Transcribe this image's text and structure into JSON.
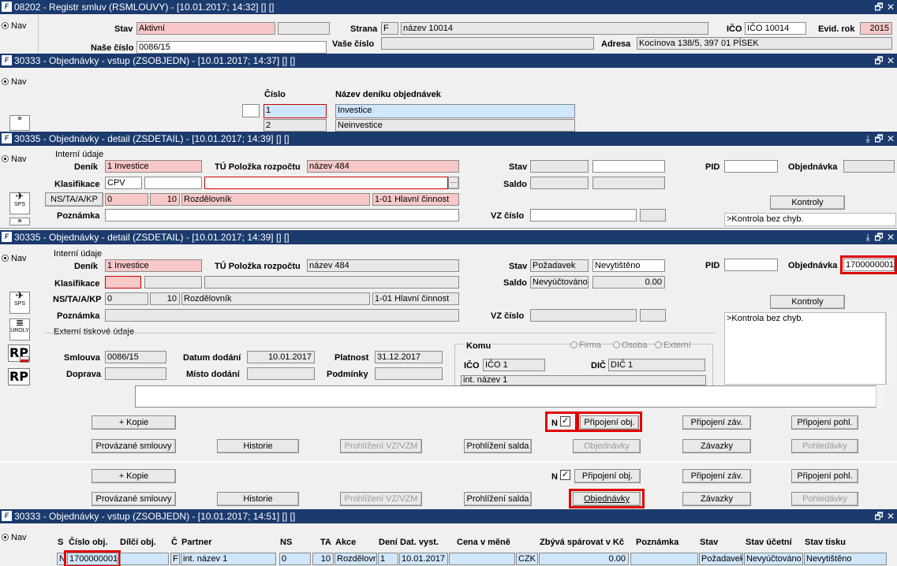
{
  "w1": {
    "title": "08202 - Registr smluv (RSMLOUVY) - [10.01.2017; 14:32] [] []",
    "nav": "Nav",
    "stav_label": "Stav",
    "stav_value": "Aktivní",
    "nase_cislo_label": "Naše číslo",
    "nase_cislo_value": "0086/15",
    "strana_label": "Strana",
    "strana_code": "F",
    "strana_value": "název 10014",
    "vase_cislo_label": "Vaše číslo",
    "ico_label": "IČO",
    "ico_value": "IČO 10014",
    "evid_rok_label": "Evid. rok",
    "evid_rok_value": "2015",
    "adresa_label": "Adresa",
    "adresa_value": "Kocínova 138/5, 397 01 PÍSEK"
  },
  "w2": {
    "title": "30333 - Objednávky - vstup (ZSOBJEDN) - [10.01.2017; 14:37] [] []",
    "nav": "Nav",
    "col_cislo": "Číslo",
    "col_nazev": "Název deníku objednávek",
    "rows": [
      {
        "cislo": "1",
        "nazev": "Investice"
      },
      {
        "cislo": "2",
        "nazev": "Neinvestice"
      }
    ]
  },
  "w3": {
    "title": "30335 - Objednávky - detail (ZSDETAIL) - [10.01.2017; 14:39] [] []",
    "nav": "Nav",
    "group": "Interní údaje",
    "denik_label": "Deník",
    "denik_value": "1 Investice",
    "tu_label": "TÚ Položka rozpočtu",
    "tu_value": "název 484",
    "klasifikace_label": "Klasifikace",
    "klasifikace_value": "CPV",
    "ns_button": "NS/TA/A/KP",
    "ns_value": "0",
    "ta_value": "10",
    "a_value": "Rozdělovník",
    "kp_value": "1-01 Hlavní činnost",
    "poznamka_label": "Poznámka",
    "stav_label": "Stav",
    "saldo_label": "Saldo",
    "vz_label": "VZ číslo",
    "pid_label": "PID",
    "objednavka_label": "Objednávka",
    "kontroly_button": "Kontroly",
    "kontroly_text": ">Kontrola bez chyb.",
    "ellipsis": "···"
  },
  "w4": {
    "title": "30335 - Objednávky - detail (ZSDETAIL) - [10.01.2017; 14:39] [] []",
    "nav": "Nav",
    "group": "Interní údaje",
    "denik_label": "Deník",
    "denik_value": "1 Investice",
    "tu_label": "TÚ Položka rozpočtu",
    "tu_value": "název 484",
    "klasifikace_label": "Klasifikace",
    "ns_label": "NS/TA/A/KP",
    "ns_value": "0",
    "ta_value": "10",
    "a_value": "Rozdělovník",
    "kp_value": "1-01 Hlavní činnost",
    "poznamka_label": "Poznámka",
    "stav_label": "Stav",
    "stav_value1": "Požadavek",
    "stav_value2": "Nevytištěno",
    "saldo_label": "Saldo",
    "saldo_value1": "Nevyúčtováno",
    "saldo_value2": "0.00",
    "vz_label": "VZ číslo",
    "pid_label": "PID",
    "objednavka_label": "Objednávka",
    "objednavka_value": "1700000001",
    "kontroly_button": "Kontroly",
    "kontroly_text": ">Kontrola bez chyb.",
    "ext_group": "Externí tiskové údaje",
    "smlouva_label": "Smlouva",
    "smlouva_value": "0086/15",
    "datum_dodani_label": "Datum dodání",
    "datum_dodani_value": "10.01.2017",
    "platnost_label": "Platnost",
    "platnost_value": "31.12.2017",
    "doprava_label": "Doprava",
    "misto_label": "Místo dodání",
    "podminky_label": "Podmínky",
    "komu_label": "Komu",
    "radio_firma": "Firma",
    "radio_osoba": "Osoba",
    "radio_externi": "Externí",
    "ico_label": "IČO",
    "ico_value": "IČO 1",
    "dic_label": "DIČ",
    "dic_value": "DIČ 1",
    "int_nazev": "int. název 1"
  },
  "buttons1": {
    "kopie": "+ Kopie",
    "n_label": "N",
    "check": "✓",
    "pripojeni_obj": "Připojení obj.",
    "pripojeni_zav": "Připojení záv.",
    "pripojeni_pohl": "Připojení pohl.",
    "provazane": "Provázané smlouvy",
    "historie": "Historie",
    "prohlizeni_vz": "Prohlížení VZ/VZM",
    "prohlizeni_salda": "Prohlížení salda",
    "objednavky": "Objednávky",
    "zavazky": "Závazky",
    "pohledavky": "Pohledávky"
  },
  "buttons2": {
    "kopie": "+ Kopie",
    "n_label": "N",
    "check": "✓",
    "pripojeni_obj": "Připojení obj.",
    "pripojeni_zav": "Připojení záv.",
    "pripojeni_pohl": "Připojení pohl.",
    "provazane": "Provázané smlouvy",
    "historie": "Historie",
    "prohlizeni_vz": "Prohlížení VZ/VZM",
    "prohlizeni_salda": "Prohlížení salda",
    "objednavky": "Objednávky",
    "zavazky": "Závazky",
    "pohledavky": "Pohledávky"
  },
  "w5": {
    "title": "30333 - Objednávky - vstup (ZSOBJEDN) - [10.01.2017; 14:51] [] []",
    "nav": "Nav",
    "headers": {
      "s": "S",
      "cislo": "Číslo obj.",
      "dilci": "Dílčí obj.",
      "c": "Č",
      "partner": "Partner",
      "ns": "NS",
      "ta": "TA",
      "akce": "Akce",
      "deni": "Dení",
      "dat_vyst": "Dat. vyst.",
      "cena": "Cena v měně",
      "zbyva": "Zbývá spárovat v Kč",
      "poznamka": "Poznámka",
      "stav": "Stav",
      "stav_ucetni": "Stav účetní",
      "stav_tisku": "Stav tisku"
    },
    "row": {
      "s": "N",
      "cislo": "1700000001",
      "c": "F",
      "partner": "int. název 1",
      "ns": "0",
      "ta": "10",
      "akce": "Rozdělovn",
      "deni": "1",
      "dat_vyst": "10.01.2017",
      "mena": "CZK",
      "zbyva": "0.00",
      "stav": "Požadavek",
      "stav_ucetni": "Nevyúčtováno",
      "stav_tisku": "Nevytištěno"
    }
  },
  "window_controls": {
    "restore": "🗗",
    "close": "✕",
    "min": "⤓"
  },
  "side_icons": {
    "sps": "SPS",
    "uroly": "ÚROLY",
    "rp": "RP"
  },
  "colors": {
    "titlebar": "#1b3a6e",
    "required": "#f8c8c8",
    "selected": "#cfe6fb",
    "highlight": "#e00000"
  }
}
